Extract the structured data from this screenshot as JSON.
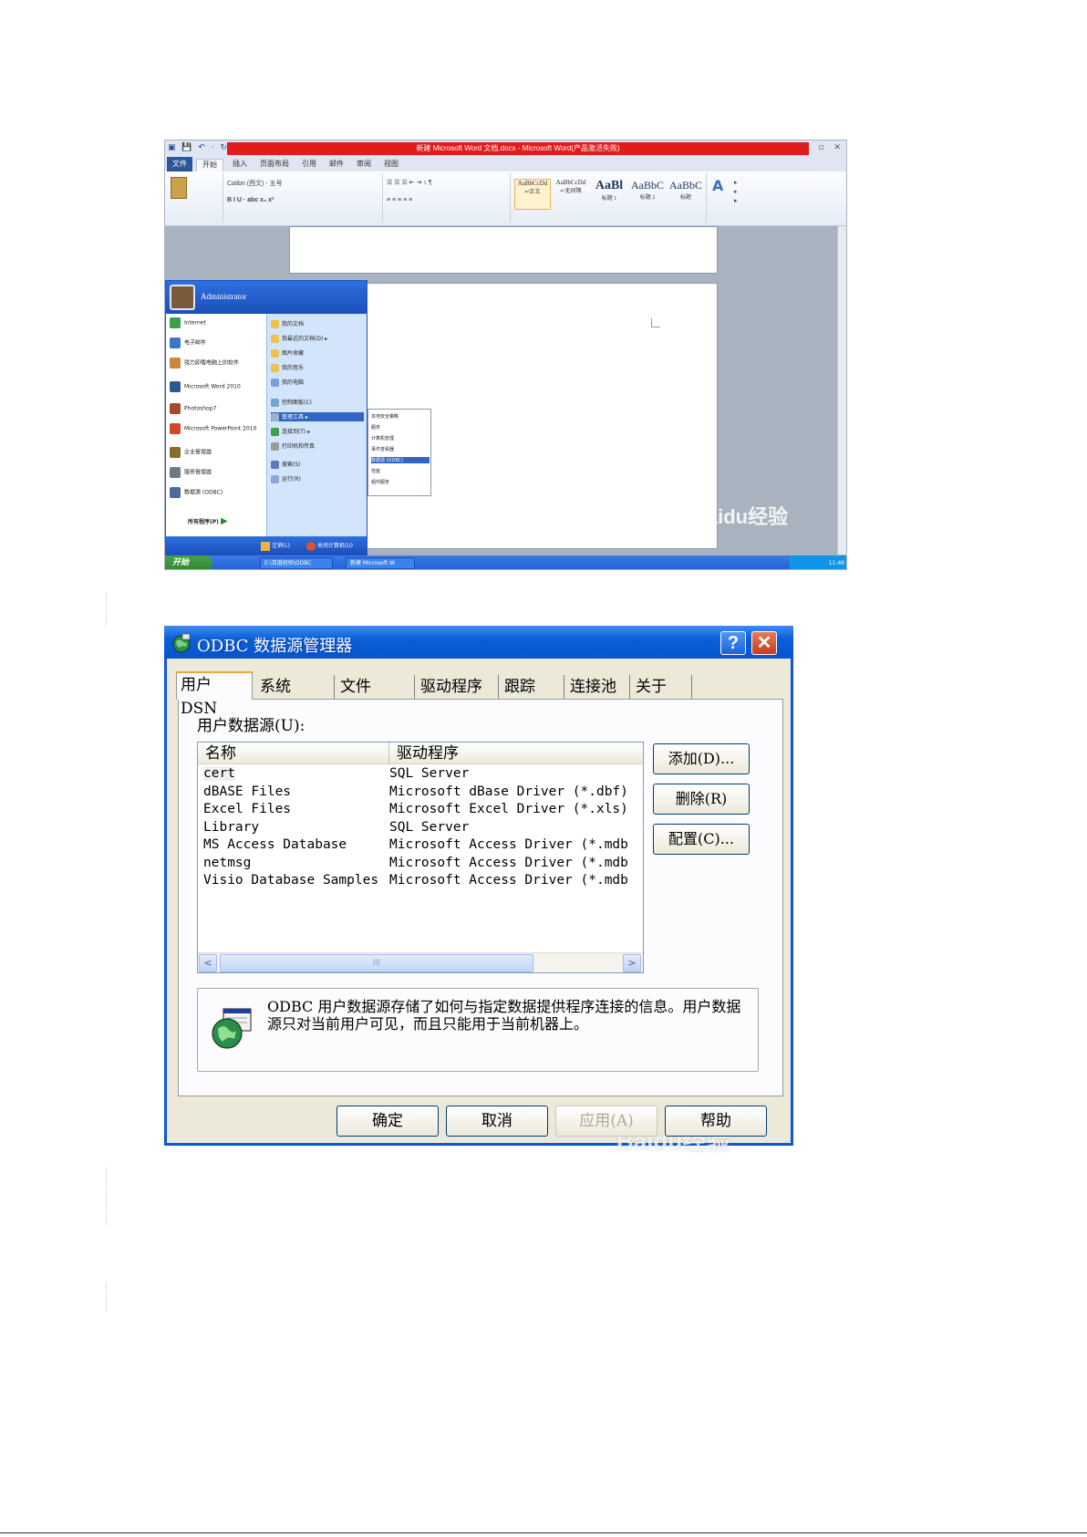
{
  "word_screenshot": {
    "title": "新建 Microsoft Word 文档.docx - Microsoft Word(产品激活失败)",
    "ribbon_tabs": [
      "文件",
      "开始",
      "插入",
      "页面布局",
      "引用",
      "邮件",
      "审阅",
      "视图"
    ],
    "font_box": "Calibri (西文) - 五号",
    "style_samples": [
      "AaBbCcDd",
      "AaBbCcDd",
      "AaBl",
      "AaBbC",
      "AaBbC"
    ],
    "style_labels": [
      "↵正文",
      "↵无间隔",
      "标题 1",
      "标题 2",
      "标题"
    ],
    "start_menu": {
      "user": "Administrator",
      "left_items": [
        "Internet",
        "电子邮件",
        "强力卸载电脑上的软件",
        "Microsoft Word 2010",
        "Photoshop7",
        "Microsoft PowerPoint 2010",
        "企业管理器",
        "服务管理器",
        "数据源 (ODBC)"
      ],
      "all_programs": "所有程序(P)",
      "right_items": [
        "我的文档",
        "我最近的文档(D)",
        "图片收藏",
        "我的音乐",
        "我的电脑",
        "控制面板(C)",
        "管理工具",
        "连接到(T)",
        "打印机和传真",
        "搜索(S)",
        "运行(R)"
      ],
      "logoff": "注销(L)",
      "shutdown": "关闭计算机(U)"
    },
    "submenu_items": [
      "本地安全策略",
      "服务",
      "计算机管理",
      "事件查看器",
      "数据源 (ODBC)",
      "性能",
      "组件服务"
    ],
    "taskbar": {
      "start": "开始",
      "items": [
        "E:\\百度经验\\ODBC",
        "新建 Microsoft W"
      ],
      "clock": "11:46"
    },
    "watermark": "Baidu经验"
  },
  "dialog": {
    "title": "ODBC 数据源管理器",
    "help_glyph": "?",
    "close_glyph": "✕",
    "tabs": [
      "用户 DSN",
      "系统 DSN",
      "文件 DSN",
      "驱动程序",
      "跟踪",
      "连接池",
      "关于"
    ],
    "section_label": "用户数据源(U):",
    "columns": [
      "名称",
      "驱动程序"
    ],
    "rows": [
      {
        "name": "cert",
        "driver": "SQL Server"
      },
      {
        "name": "dBASE Files",
        "driver": "Microsoft dBase Driver (*.dbf)"
      },
      {
        "name": "Excel Files",
        "driver": "Microsoft Excel Driver (*.xls)"
      },
      {
        "name": "Library",
        "driver": "SQL Server"
      },
      {
        "name": "MS Access Database",
        "driver": "Microsoft Access Driver (*.mdb"
      },
      {
        "name": "netmsg",
        "driver": "Microsoft Access Driver (*.mdb"
      },
      {
        "name": "Visio Database Samples",
        "driver": "Microsoft Access Driver (*.mdb"
      }
    ],
    "scroll_left": "<",
    "scroll_right": ">",
    "scroll_thumb": "III",
    "side_buttons": {
      "add": "添加(D)...",
      "remove": "删除(R)",
      "configure": "配置(C)..."
    },
    "info_text": "ODBC 用户数据源存储了如何与指定数据提供程序连接的信息。用户数据源只对当前用户可见，而且只能用于当前机器上。",
    "buttons": {
      "ok": "确定",
      "cancel": "取消",
      "apply": "应用(A)",
      "help": "帮助"
    },
    "watermark": "Baidu经验"
  }
}
